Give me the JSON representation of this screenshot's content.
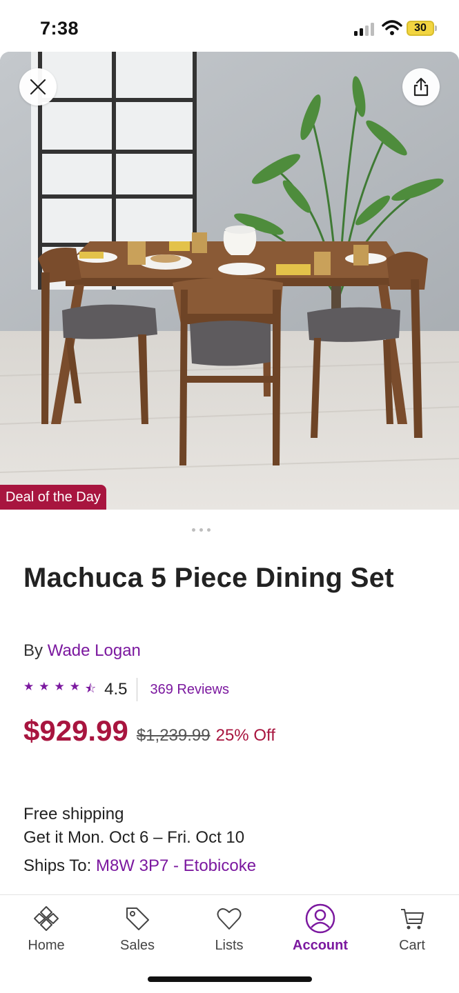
{
  "status_bar": {
    "time": "7:38",
    "battery": "30"
  },
  "hero": {
    "badge": "Deal of the Day",
    "image_icon": "dining-set-photo",
    "close_icon": "close-icon",
    "share_icon": "share-icon"
  },
  "product": {
    "title": "Machuca 5 Piece Dining Set",
    "by_label": "By",
    "brand": "Wade Logan",
    "rating": "4.5",
    "rating_fraction": 0.9,
    "reviews": "369 Reviews",
    "price": "$929.99",
    "original_price": "$1,239.99",
    "discount": "25% Off"
  },
  "shipping": {
    "free": "Free shipping",
    "delivery": "Get it Mon. Oct 6 – Fri. Oct 10",
    "ships_to_label": "Ships To:",
    "ships_to_value": "M8W 3P7 - Etobicoke"
  },
  "nav": {
    "items": [
      {
        "label": "Home",
        "icon": "home-icon"
      },
      {
        "label": "Sales",
        "icon": "tag-icon"
      },
      {
        "label": "Lists",
        "icon": "heart-icon"
      },
      {
        "label": "Account",
        "icon": "account-icon",
        "active": true
      },
      {
        "label": "Cart",
        "icon": "cart-icon"
      }
    ]
  },
  "colors": {
    "brand_purple": "#7b189f",
    "price_red": "#a8153f"
  }
}
